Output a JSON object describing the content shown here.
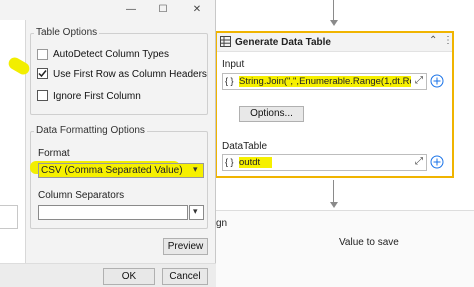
{
  "canvas": {
    "card": {
      "title": "Generate Data Table",
      "input_label": "Input",
      "input_prefix": "{ }",
      "input_expression": "String.Join(\",\",Enumerable.Range(1,dt.RowC",
      "options_label": "Options...",
      "datatable_label": "DataTable",
      "datatable_prefix": "{ }",
      "datatable_value": "outdt"
    },
    "lower_text_partial": "gn",
    "lower_column": "Value to save"
  },
  "dialog": {
    "window_buttons": {
      "minimize": "—",
      "maximize": "☐",
      "close": "✕"
    },
    "table_options": {
      "label": "Table Options",
      "autodetect_label": "AutoDetect Column Types",
      "autodetect_checked": false,
      "first_row_label": "Use First Row as Column Headers",
      "first_row_checked": true,
      "ignore_label": "Ignore First Column",
      "ignore_checked": false
    },
    "formatting": {
      "label": "Data Formatting Options",
      "format_label": "Format",
      "format_value": "CSV (Comma Separated Value)",
      "separators_label": "Column Separators",
      "separators_value": ""
    },
    "preview_label": "Preview",
    "ok_label": "OK",
    "cancel_label": "Cancel"
  },
  "colors": {
    "highlight": "#f6f000",
    "card_border": "#f0b400",
    "accent": "#1a73e8"
  }
}
